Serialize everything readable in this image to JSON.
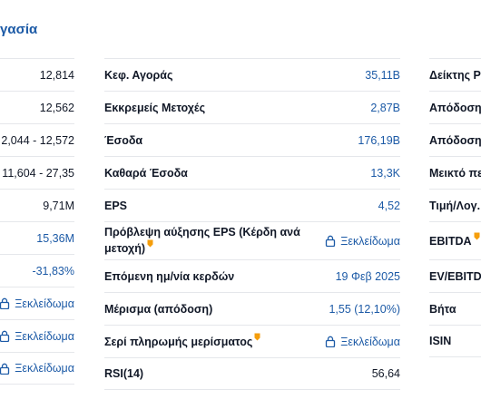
{
  "section_title": "γασία",
  "left_column": [
    {
      "value": "12,814",
      "style": "plain"
    },
    {
      "value": "12,562",
      "style": "plain"
    },
    {
      "value": "2,044 - 12,572",
      "style": "plain"
    },
    {
      "value": "11,604 - 27,35",
      "style": "plain"
    },
    {
      "value": "9,71M",
      "style": "plain"
    },
    {
      "value": "15,36M",
      "style": "link"
    },
    {
      "value": "-31,83%",
      "style": "link"
    },
    {
      "value": "Ξεκλείδωμα",
      "style": "lock"
    },
    {
      "value": "Ξεκλείδωμα",
      "style": "lock"
    },
    {
      "value": "Ξεκλείδωμα",
      "style": "lock"
    }
  ],
  "middle_column": [
    {
      "label": "Κεφ. Αγοράς",
      "value": "35,11B",
      "style": "link"
    },
    {
      "label": "Εκκρεμείς Μετοχές",
      "value": "2,87B",
      "style": "link"
    },
    {
      "label": "Έσοδα",
      "value": "176,19B",
      "style": "link"
    },
    {
      "label": "Καθαρά Έσοδα",
      "value": "13,3K",
      "style": "link"
    },
    {
      "label": "EPS",
      "value": "4,52",
      "style": "link"
    },
    {
      "label": "Πρόβλεψη αύξησης EPS (Κέρδη ανά μετοχή)",
      "value": "Ξεκλείδωμα",
      "style": "lock",
      "pro": true
    },
    {
      "label": "Επόμενη ημ/νία κερδών",
      "value": "19 Φεβ 2025",
      "style": "link"
    },
    {
      "label": "Μέρισμα (απόδοση)",
      "value": "1,55 (12,10%)",
      "style": "link"
    },
    {
      "label": "Σερί πληρωμής μερίσματος",
      "value": "Ξεκλείδωμα",
      "style": "lock",
      "pro": true
    },
    {
      "label": "RSI(14)",
      "value": "56,64",
      "style": "plain"
    }
  ],
  "right_column": [
    {
      "label": "Δείκτης P"
    },
    {
      "label": "Απόδοση"
    },
    {
      "label": "Απόδοση"
    },
    {
      "label": "Μεικτό πε"
    },
    {
      "label": "Τιμή/Λογ."
    },
    {
      "label": "EBITDA",
      "pro": true
    },
    {
      "label": "EV/EBITDA"
    },
    {
      "label": "Βήτα"
    },
    {
      "label": "ISIN"
    }
  ],
  "colors": {
    "link": "#1c5aa6",
    "pro_badge": "#f59e0b",
    "divider": "#e5e7eb"
  }
}
